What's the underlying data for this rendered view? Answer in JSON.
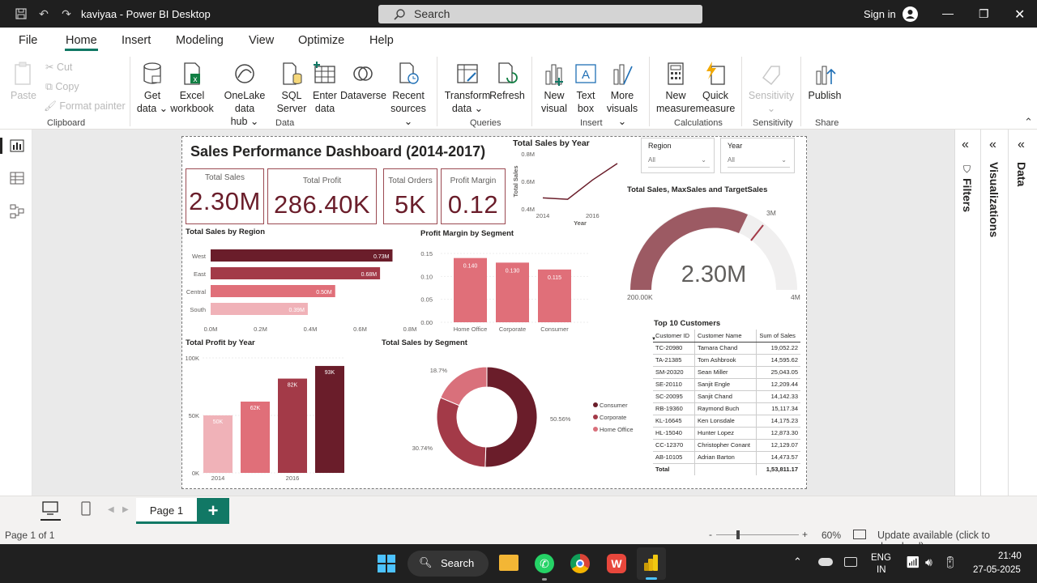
{
  "window": {
    "title": "kaviyaa - Power BI Desktop",
    "search_placeholder": "Search",
    "signin": "Sign in"
  },
  "menu": [
    "File",
    "Home",
    "Insert",
    "Modeling",
    "View",
    "Optimize",
    "Help"
  ],
  "ribbon": {
    "clipboard": {
      "paste": "Paste",
      "cut": "Cut",
      "copy": "Copy",
      "format_painter": "Format painter",
      "group": "Clipboard"
    },
    "data": {
      "get_data": "Get",
      "get_data2": "data",
      "excel": "Excel",
      "excel2": "workbook",
      "onelake": "OneLake data",
      "onelake2": "hub",
      "sql": "SQL",
      "sql2": "Server",
      "enter": "Enter",
      "enter2": "data",
      "dataverse": "Dataverse",
      "recent": "Recent",
      "recent2": "sources",
      "group": "Data"
    },
    "queries": {
      "transform": "Transform",
      "transform2": "data",
      "refresh": "Refresh",
      "group": "Queries"
    },
    "insert": {
      "new_visual": "New",
      "new_visual2": "visual",
      "text_box": "Text",
      "text_box2": "box",
      "more": "More",
      "more2": "visuals",
      "group": "Insert"
    },
    "calculations": {
      "new_measure": "New",
      "new_measure2": "measure",
      "quick": "Quick",
      "quick2": "measure",
      "group": "Calculations"
    },
    "sensitivity": {
      "label": "Sensitivity",
      "group": "Sensitivity"
    },
    "share": {
      "publish": "Publish",
      "group": "Share"
    }
  },
  "dashboard": {
    "title": "Sales Performance Dashboard (2014-2017)",
    "kpis": [
      {
        "label": "Total Sales",
        "value": "2.30M"
      },
      {
        "label": "Total Profit",
        "value": "286.40K"
      },
      {
        "label": "Total Orders",
        "value": "5K"
      },
      {
        "label": "Profit Margin",
        "value": "0.12"
      }
    ],
    "slicers": [
      {
        "label": "Region",
        "value": "All"
      },
      {
        "label": "Year",
        "value": "All"
      }
    ],
    "gauge": {
      "title": "Total Sales, MaxSales and TargetSales",
      "value": "2.30M",
      "min": "200.00K",
      "max": "4M",
      "target": "3M"
    },
    "customers": {
      "title": "Top 10 Customers",
      "headers": [
        "Customer ID",
        "Customer Name",
        "Sum of Sales"
      ],
      "rows": [
        [
          "TC-20980",
          "Tamara Chand",
          "19,052.22"
        ],
        [
          "TA-21385",
          "Tom Ashbrook",
          "14,595.62"
        ],
        [
          "SM-20320",
          "Sean Miller",
          "25,043.05"
        ],
        [
          "SE-20110",
          "Sanjit Engle",
          "12,209.44"
        ],
        [
          "SC-20095",
          "Sanjit Chand",
          "14,142.33"
        ],
        [
          "RB-19360",
          "Raymond Buch",
          "15,117.34"
        ],
        [
          "KL-16645",
          "Ken Lonsdale",
          "14,175.23"
        ],
        [
          "HL-15040",
          "Hunter Lopez",
          "12,873.30"
        ],
        [
          "CC-12370",
          "Christopher Conant",
          "12,129.07"
        ],
        [
          "AB-10105",
          "Adrian Barton",
          "14,473.57"
        ]
      ],
      "total_label": "Total",
      "total_value": "1,53,811.17"
    }
  },
  "chart_data": [
    {
      "type": "line",
      "title": "Total Sales by Year",
      "ylabel": "Total Sales",
      "xlabel": "Year",
      "x": [
        2014,
        2015,
        2016,
        2017
      ],
      "y": [
        0.48,
        0.47,
        0.61,
        0.73
      ],
      "ylim": [
        0.4,
        0.8
      ],
      "yticks": [
        "0.4M",
        "0.6M",
        "0.8M"
      ],
      "xticks": [
        "2014",
        "2016"
      ]
    },
    {
      "type": "bar",
      "title": "Total Sales by Region",
      "orientation": "horizontal",
      "categories": [
        "West",
        "East",
        "Central",
        "South"
      ],
      "values": [
        0.73,
        0.68,
        0.5,
        0.39
      ],
      "labels": [
        "0.73M",
        "0.68M",
        "0.50M",
        "0.39M"
      ],
      "xticks": [
        "0.0M",
        "0.2M",
        "0.4M",
        "0.6M",
        "0.8M"
      ],
      "xlim": [
        0,
        0.8
      ]
    },
    {
      "type": "bar",
      "title": "Profit Margin by Segment",
      "categories": [
        "Home Office",
        "Corporate",
        "Consumer"
      ],
      "values": [
        0.14,
        0.13,
        0.115
      ],
      "labels": [
        "0.140",
        "0.130",
        "0.115"
      ],
      "yticks": [
        "0.00",
        "0.05",
        "0.10",
        "0.15"
      ],
      "ylim": [
        0,
        0.15
      ]
    },
    {
      "type": "bar",
      "title": "Total Profit by Year",
      "categories": [
        "2014",
        "2015",
        "2016",
        "2017"
      ],
      "values": [
        50,
        62,
        82,
        93
      ],
      "labels": [
        "50K",
        "62K",
        "82K",
        "93K"
      ],
      "yticks": [
        "0K",
        "50K",
        "100K"
      ],
      "xticks": [
        "2014",
        "2016"
      ],
      "ylim": [
        0,
        100
      ]
    },
    {
      "type": "pie",
      "title": "Total Sales by Segment",
      "categories": [
        "Consumer",
        "Corporate",
        "Home Office"
      ],
      "values": [
        50.56,
        30.74,
        18.7
      ],
      "labels": [
        "50.56%",
        "30.74%",
        "18.7%"
      ],
      "colors": [
        "#6a1d2a",
        "#a33a48",
        "#d9707b"
      ]
    }
  ],
  "colors": {
    "maroon": "#6a1d2a",
    "mid": "#a33a48",
    "rose": "#e06f79",
    "pale": "#f0b2b8",
    "teal": "#117865"
  },
  "pages": {
    "current": "Page 1",
    "status": "Page 1 of 1",
    "zoom": "60%",
    "update": "Update available (click to download)"
  },
  "panes": {
    "filters": "Filters",
    "visualizations": "Visualizations",
    "data": "Data"
  },
  "taskbar": {
    "search": "Search",
    "lang1": "ENG",
    "lang2": "IN",
    "time": "21:40",
    "date": "27-05-2025"
  }
}
